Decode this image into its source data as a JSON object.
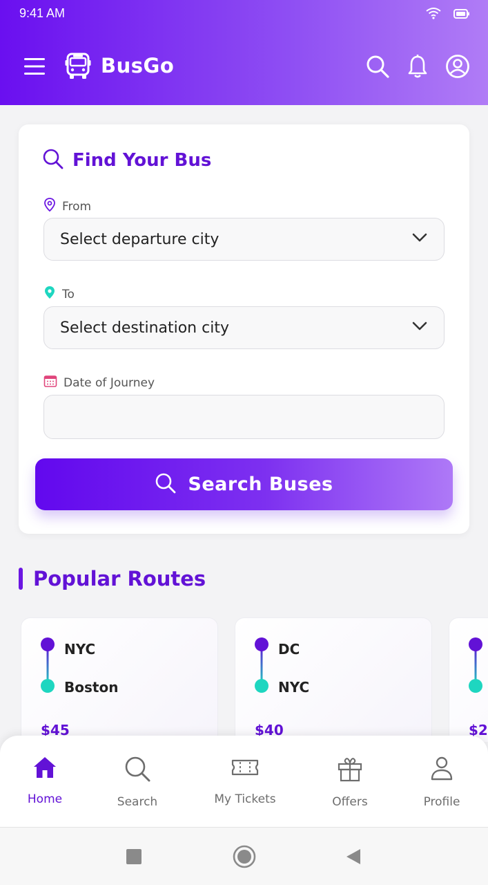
{
  "status_bar": {
    "time": "9:41 AM"
  },
  "app": {
    "title": "BusGo"
  },
  "search_card": {
    "title": "Find Your Bus",
    "from_label": "From",
    "from_value": "Select departure city",
    "to_label": "To",
    "to_value": "Select destination city",
    "date_label": "Date of Journey",
    "date_value": "",
    "button_label": "Search Buses"
  },
  "popular_routes": {
    "title": "Popular Routes",
    "routes": [
      {
        "from": "NYC",
        "to": "Boston",
        "price": "$45"
      },
      {
        "from": "DC",
        "to": "NYC",
        "price": "$40"
      },
      {
        "from": "",
        "to": "",
        "price": "$2"
      }
    ]
  },
  "bottom_nav": {
    "items": [
      {
        "label": "Home",
        "icon": "home-icon",
        "active": true
      },
      {
        "label": "Search",
        "icon": "search-icon"
      },
      {
        "label": "My Tickets",
        "icon": "ticket-icon"
      },
      {
        "label": "Offers",
        "icon": "gift-icon"
      },
      {
        "label": "Profile",
        "icon": "person-icon"
      }
    ]
  },
  "colors": {
    "primary": "#6212d6",
    "gradient_start": "#6a0ff0",
    "gradient_end": "#b07cf6",
    "accent_teal": "#1ed6c0",
    "calendar_pink": "#e0457b"
  }
}
